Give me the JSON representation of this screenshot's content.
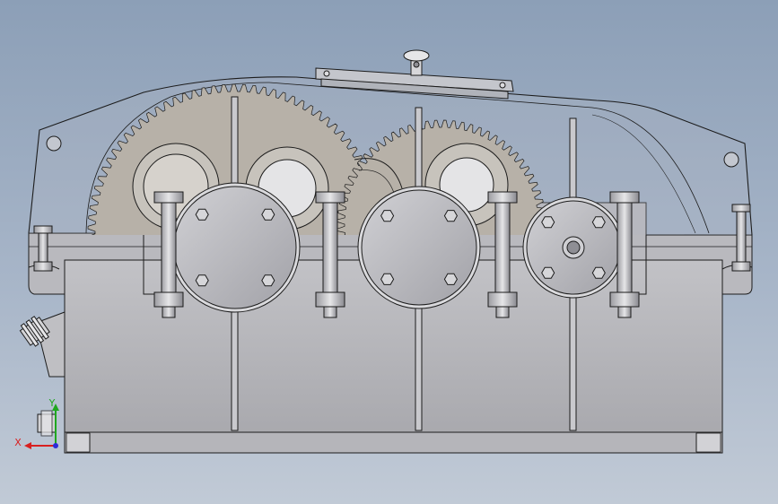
{
  "colors": {
    "background_top": "#8c9fb7",
    "background_bottom": "#c1cad6",
    "housing": "#b8b8bd",
    "cover": "#b3b6bd",
    "gear": "#b7b1a8",
    "outline": "#1c1c1c",
    "axis_x": "#d81f1f",
    "axis_y": "#1fa71f",
    "axis_z": "#2c2cd8"
  },
  "triad": {
    "x_label": "X",
    "y_label": "Y"
  },
  "icons": {
    "triad": "coordinate-triad-icon",
    "breather": "breather-cap-icon",
    "oil_plug": "oil-plug-icon"
  }
}
